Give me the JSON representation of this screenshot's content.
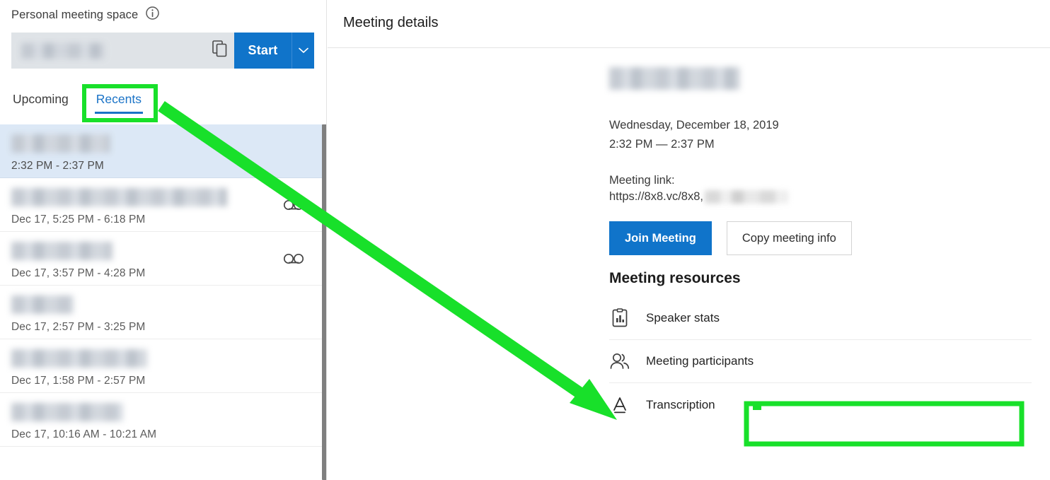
{
  "sidebar": {
    "personal_space_label": "Personal meeting space",
    "info_icon": "info-icon",
    "room_value_redacted": "",
    "copy_icon": "copy-icon",
    "start_label": "Start",
    "start_caret_icon": "chevron-down-icon",
    "tabs": [
      {
        "label": "Upcoming",
        "active": false
      },
      {
        "label": "Recents",
        "active": true
      }
    ],
    "meetings": [
      {
        "title_redacted": "",
        "time": "2:32 PM - 2:37 PM",
        "selected": true,
        "has_recording": false,
        "title_width": 140
      },
      {
        "title_redacted": "",
        "time": "Dec 17, 5:25 PM - 6:18 PM",
        "selected": false,
        "has_recording": true,
        "title_width": 305
      },
      {
        "title_redacted": "",
        "time": "Dec 17, 3:57 PM - 4:28 PM",
        "selected": false,
        "has_recording": true,
        "title_width": 143
      },
      {
        "title_redacted": "",
        "time": "Dec 17, 2:57 PM - 3:25 PM",
        "selected": false,
        "has_recording": false,
        "title_width": 88
      },
      {
        "title_redacted": "",
        "time": "Dec 17, 1:58 PM - 2:57 PM",
        "selected": false,
        "has_recording": false,
        "title_width": 192
      },
      {
        "title_redacted": "",
        "time": "Dec 17, 10:16 AM - 10:21 AM",
        "selected": false,
        "has_recording": false,
        "title_width": 158
      }
    ]
  },
  "detail": {
    "header_title": "Meeting details",
    "meeting_name_redacted": "",
    "date": "Wednesday, December 18, 2019",
    "time_range": "2:32 PM — 2:37 PM",
    "meeting_link_label": "Meeting link:",
    "meeting_link_prefix": "https://8x8.vc/8x8,",
    "meeting_link_suffix_redacted": "",
    "join_label": "Join Meeting",
    "copy_info_label": "Copy meeting info",
    "resources_title": "Meeting resources",
    "resources": [
      {
        "label": "Speaker stats",
        "icon": "speaker-stats-icon"
      },
      {
        "label": "Meeting participants",
        "icon": "participants-icon"
      },
      {
        "label": "Transcription",
        "icon": "transcription-icon"
      }
    ]
  },
  "annotations": {
    "highlight_color": "#18e02a",
    "arrow": "green-arrow-pointer",
    "targets": [
      "Recents",
      "Transcription"
    ]
  },
  "colors": {
    "primary_blue": "#1074ca",
    "tab_active_blue": "#1a73c7",
    "selected_row": "#dce8f6",
    "annotation_green": "#18e02a"
  }
}
